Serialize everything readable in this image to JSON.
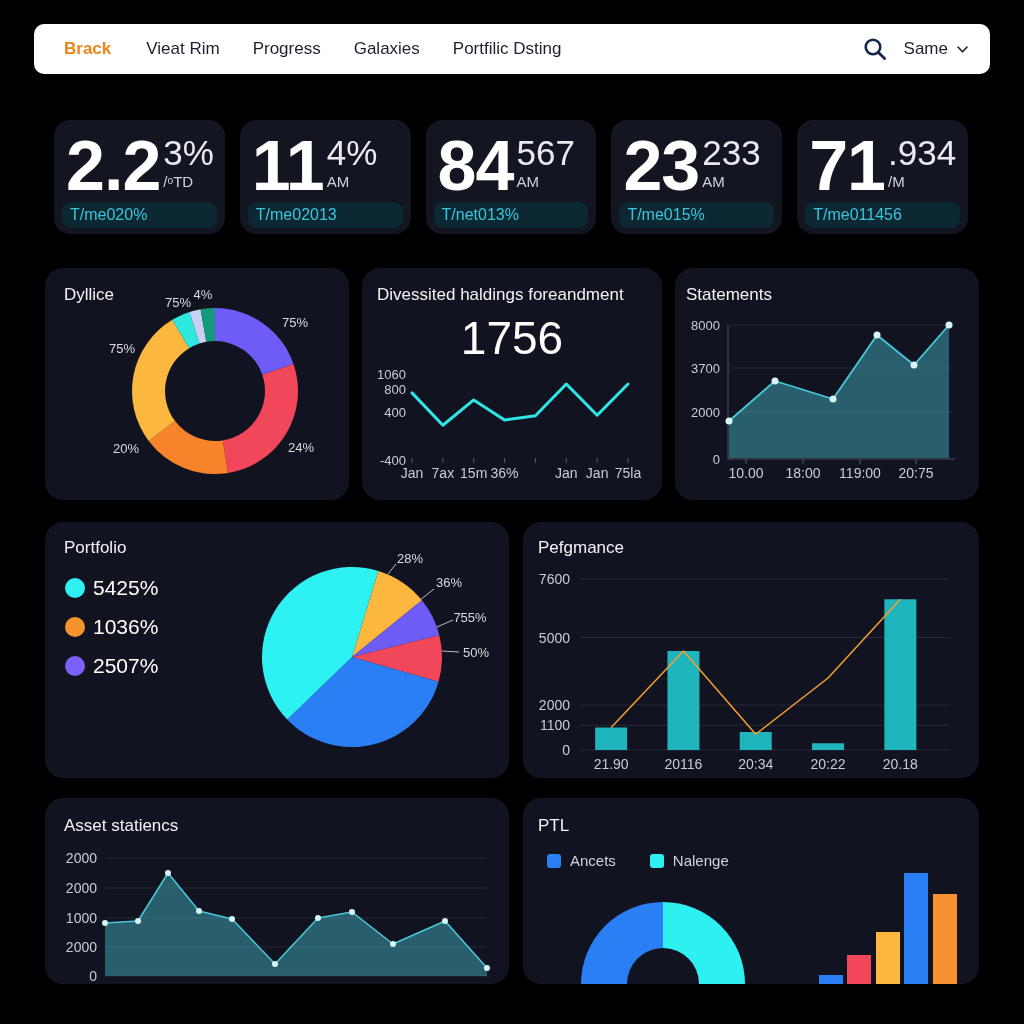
{
  "navbar": {
    "brand": "Brack",
    "links": [
      "Vieat Rim",
      "Progress",
      "Galaxies",
      "Portfilic Dsting"
    ],
    "user_menu": "Same"
  },
  "stats": [
    {
      "value": "2.2",
      "fraction": "3%",
      "unit": "/ᵒTD",
      "tag": "T/me020%"
    },
    {
      "value": "11",
      "fraction": "4%",
      "unit": "AM",
      "tag": "T/me02013"
    },
    {
      "value": "84",
      "fraction": "567",
      "unit": "AM",
      "tag": "T/net013%"
    },
    {
      "value": "23",
      "fraction": "233",
      "unit": "AM",
      "tag": "T/me015%"
    },
    {
      "value": "71",
      "fraction": ".934",
      "unit": "/M",
      "tag": "T/me011456"
    }
  ],
  "donut_card": {
    "title": "Dyllice",
    "slice_labels": [
      "75%",
      "4%",
      "75%",
      "75%",
      "20%",
      "24%"
    ]
  },
  "line_card": {
    "total": "1756",
    "chart_data": {
      "type": "line",
      "title": "Divessited haldings foreandment",
      "categories": [
        "Jan",
        "7ax",
        "15m",
        "36%",
        null,
        "Jan",
        "Jan",
        "75la"
      ],
      "series": [
        {
          "color": "#2ee6e6",
          "values": [
            740,
            190,
            620,
            280,
            350,
            890,
            360,
            890
          ]
        }
      ],
      "ylim": [
        -400,
        1060
      ],
      "yticks": [
        -400,
        400,
        800,
        1060
      ]
    }
  },
  "statements_card": {
    "title": "Statements",
    "y_labels": [
      "8000",
      "3700",
      "2000",
      "0"
    ],
    "x_labels": [
      "10.00",
      "18:00",
      "119:00",
      "20:75"
    ]
  },
  "portfolio_card": {
    "title": "Portfolio",
    "legend": [
      {
        "label": "5425%",
        "color": "#2ef2f2"
      },
      {
        "label": "1036%",
        "color": "#f7932e"
      },
      {
        "label": "2507%",
        "color": "#7b61f5"
      }
    ],
    "slice_labels": [
      "28%",
      "36%",
      "755%",
      "50%"
    ]
  },
  "performance_card": {
    "chart_data": {
      "type": "bar",
      "title": "Pefgmance",
      "categories": [
        "21.90",
        "20116",
        "20:34",
        "20:22",
        "20.18"
      ],
      "series": [
        {
          "color": "#1fb5bd",
          "values": [
            1000,
            4400,
            800,
            300,
            6700
          ]
        },
        {
          "type": "line",
          "color": "#f5a030",
          "values": [
            1000,
            4400,
            700,
            3200,
            6700
          ]
        }
      ],
      "ylim": [
        0,
        7600
      ],
      "yticks": [
        0,
        1100,
        2000,
        5000,
        7600
      ],
      "grid": true
    }
  },
  "asset_card": {
    "title": "Asset statiencs",
    "y_labels": [
      "2000",
      "2000",
      "1000",
      "2000",
      "0"
    ]
  },
  "ptl_card": {
    "title": "PTL",
    "legend": [
      {
        "label": "Ancets",
        "color": "#2a7ff5"
      },
      {
        "label": "Nalenge",
        "color": "#2ef0f0"
      }
    ]
  }
}
